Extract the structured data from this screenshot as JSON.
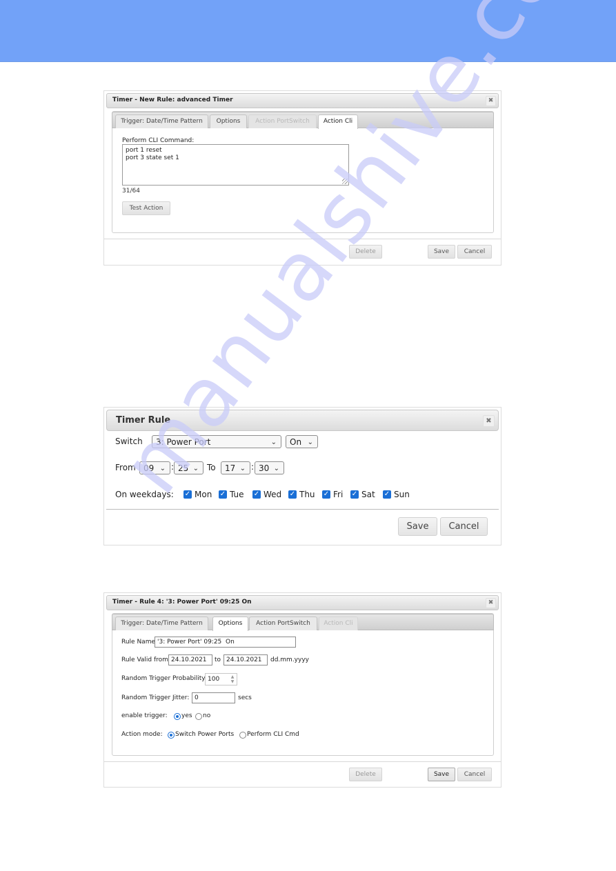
{
  "colors": {
    "banner": "#72a2f8",
    "accent": "#1a6fd6"
  },
  "watermark": "manualshive.com",
  "dialog1": {
    "title": "Timer - New Rule: advanced Timer",
    "close_icon": "close-icon",
    "tabs": [
      {
        "label": "Trigger: Date/Time Pattern",
        "state": "normal"
      },
      {
        "label": "Options",
        "state": "normal"
      },
      {
        "label": "Action PortSwitch",
        "state": "disabled"
      },
      {
        "label": "Action Cli",
        "state": "active"
      }
    ],
    "cli_label": "Perform CLI Command:",
    "cli_value": "port 1 reset\nport 3 state set 1",
    "char_count": "31/64",
    "test_button": "Test Action",
    "delete_button": "Delete",
    "save_button": "Save",
    "cancel_button": "Cancel"
  },
  "dialog2": {
    "title": "Timer Rule",
    "switch_label": "Switch",
    "switch_value": "3: Power Port",
    "state_value": "On",
    "from_label": "From",
    "from_hour": "09",
    "from_minute": "25",
    "to_label": "To",
    "to_hour": "17",
    "to_minute": "30",
    "colon": ":",
    "weekdays_label": "On weekdays:",
    "weekdays": [
      {
        "label": "Mon",
        "checked": true
      },
      {
        "label": "Tue",
        "checked": true
      },
      {
        "label": "Wed",
        "checked": true
      },
      {
        "label": "Thu",
        "checked": true
      },
      {
        "label": "Fri",
        "checked": true
      },
      {
        "label": "Sat",
        "checked": true
      },
      {
        "label": "Sun",
        "checked": true
      }
    ],
    "save_button": "Save",
    "cancel_button": "Cancel"
  },
  "dialog3": {
    "title": "Timer - Rule 4: '3: Power Port' 09:25 On",
    "tabs": [
      {
        "label": "Trigger: Date/Time Pattern",
        "state": "normal"
      },
      {
        "label": "Options",
        "state": "active"
      },
      {
        "label": "Action PortSwitch",
        "state": "normal"
      },
      {
        "label": "Action Cli",
        "state": "disabled"
      }
    ],
    "rule_name_label": "Rule Name",
    "rule_name_value": "'3: Power Port' 09:25  On",
    "valid_from_label": "Rule Valid from",
    "valid_from_value": "24.10.2021",
    "to_label": "to",
    "valid_to_value": "24.10.2021",
    "date_format": "dd.mm.yyyy",
    "probability_label": "Random Trigger Probability",
    "probability_value": "100",
    "jitter_label": "Random Trigger Jitter:",
    "jitter_value": "0",
    "jitter_unit": "secs",
    "enable_label": "enable trigger:",
    "enable_yes": "yes",
    "enable_no": "no",
    "enable_selected": "yes",
    "action_mode_label": "Action mode:",
    "action_mode_switch": "Switch Power Ports",
    "action_mode_cli": "Perform CLI Cmd",
    "action_mode_selected": "Switch Power Ports",
    "delete_button": "Delete",
    "save_button": "Save",
    "cancel_button": "Cancel"
  }
}
